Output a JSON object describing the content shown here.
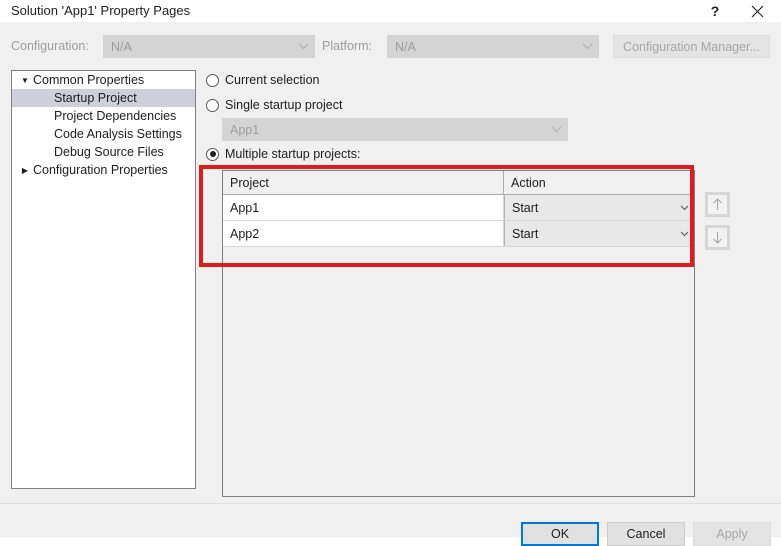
{
  "window": {
    "title": "Solution 'App1' Property Pages",
    "help_icon": "question-mark-icon",
    "close_icon": "close-icon"
  },
  "config_bar": {
    "configuration_label": "Configuration:",
    "configuration_value": "N/A",
    "platform_label": "Platform:",
    "platform_value": "N/A",
    "configuration_manager_label": "Configuration Manager..."
  },
  "tree": {
    "items": [
      {
        "label": "Common Properties",
        "level": 0,
        "twisty": "expanded",
        "selected": false
      },
      {
        "label": "Startup Project",
        "level": 1,
        "twisty": "none",
        "selected": true
      },
      {
        "label": "Project Dependencies",
        "level": 1,
        "twisty": "none",
        "selected": false
      },
      {
        "label": "Code Analysis Settings",
        "level": 1,
        "twisty": "none",
        "selected": false
      },
      {
        "label": "Debug Source Files",
        "level": 1,
        "twisty": "none",
        "selected": false
      },
      {
        "label": "Configuration Properties",
        "level": 0,
        "twisty": "collapsed",
        "selected": false
      }
    ]
  },
  "startup": {
    "current_selection_label": "Current selection",
    "single_startup_label": "Single startup project",
    "single_startup_value": "App1",
    "multiple_startup_label": "Multiple startup projects:",
    "selected_option": "multiple",
    "grid": {
      "columns": [
        "Project",
        "Action"
      ],
      "rows": [
        {
          "project": "App1",
          "action": "Start"
        },
        {
          "project": "App2",
          "action": "Start"
        }
      ]
    },
    "move_up_icon": "arrow-up-icon",
    "move_down_icon": "arrow-down-icon"
  },
  "footer": {
    "ok_label": "OK",
    "cancel_label": "Cancel",
    "apply_label": "Apply"
  },
  "annotation": {
    "color": "#e01b1b"
  }
}
